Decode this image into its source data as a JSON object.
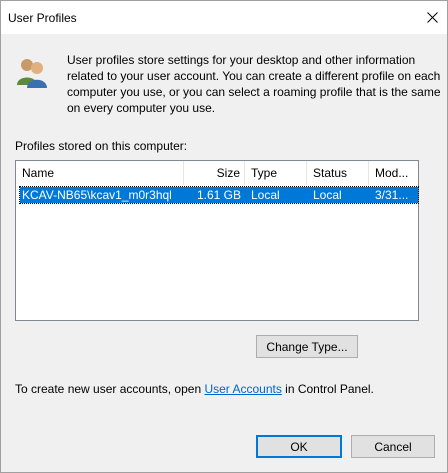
{
  "window": {
    "title": "User Profiles"
  },
  "description": "User profiles store settings for your desktop and other information related to your user account. You can create a different profile on each computer you use, or you can select a roaming profile that is the same on every computer you use.",
  "profiles_label": "Profiles stored on this computer:",
  "table": {
    "columns": [
      "Name",
      "Size",
      "Type",
      "Status",
      "Mod..."
    ],
    "rows": [
      {
        "name": "KCAV-NB65\\kcav1_m0r3hql",
        "size": "1.61 GB",
        "type": "Local",
        "status": "Local",
        "modified": "3/31..."
      }
    ]
  },
  "buttons": {
    "change_type": "Change Type...",
    "ok": "OK",
    "cancel": "Cancel"
  },
  "footer": {
    "prefix": "To create new user accounts, open ",
    "link": "User Accounts",
    "suffix": " in Control Panel."
  },
  "colors": {
    "selection": "#0078d7",
    "link": "#0066cc"
  }
}
